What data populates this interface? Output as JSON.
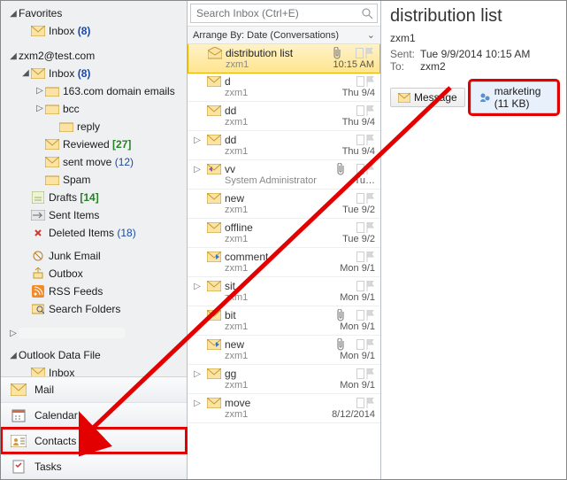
{
  "nav": {
    "favorites": {
      "label": "Favorites",
      "inbox": "Inbox",
      "inbox_count": "(8)"
    },
    "accounts": [
      {
        "name": "zxm2@test.com",
        "folders": {
          "inbox": "Inbox",
          "inbox_count": "(8)",
          "sub": {
            "f163": "163.com domain emails",
            "bcc": "bcc",
            "reply": "reply",
            "reviewed": "Reviewed",
            "reviewed_count": "[27]",
            "sentmove": "sent move",
            "sentmove_count": "(12)",
            "spam": "Spam"
          },
          "drafts": "Drafts",
          "drafts_count": "[14]",
          "sent": "Sent Items",
          "deleted": "Deleted Items",
          "deleted_count": "(18)",
          "junk": "Junk Email",
          "outbox": "Outbox",
          "rss": "RSS Feeds",
          "searchf": "Search Folders"
        }
      }
    ],
    "outlook_data_file": {
      "label": "Outlook Data File",
      "inbox": "Inbox"
    },
    "switch": {
      "mail": "Mail",
      "calendar": "Calendar",
      "contacts": "Contacts",
      "tasks": "Tasks"
    }
  },
  "search": {
    "placeholder": "Search Inbox (Ctrl+E)"
  },
  "arrange": {
    "label": "Arrange By: Date (Conversations)"
  },
  "messages": [
    {
      "subject": "distribution list",
      "from": "zxm1",
      "date": "10:15 AM",
      "attach": true,
      "selected": true,
      "env": "open"
    },
    {
      "subject": "d",
      "from": "zxm1",
      "date": "Thu 9/4",
      "env": "closed"
    },
    {
      "subject": "dd",
      "from": "zxm1",
      "date": "Thu 9/4",
      "env": "closed"
    },
    {
      "subject": "dd",
      "from": "zxm1",
      "date": "Thu 9/4",
      "expander": true,
      "env": "closed"
    },
    {
      "subject": "vv",
      "from": "System Administrator",
      "date": "Tu…",
      "attach": true,
      "expander": true,
      "env": "reply"
    },
    {
      "subject": "new",
      "from": "zxm1",
      "date": "Tue 9/2",
      "env": "closed"
    },
    {
      "subject": "offline",
      "from": "zxm1",
      "date": "Tue 9/2",
      "env": "closed"
    },
    {
      "subject": "comment",
      "from": "zxm1",
      "date": "Mon 9/1",
      "env": "fwd"
    },
    {
      "subject": "sit",
      "from": "zxm1",
      "date": "Mon 9/1",
      "expander": true,
      "env": "closed"
    },
    {
      "subject": "bit",
      "from": "zxm1",
      "date": "Mon 9/1",
      "attach": true,
      "env": "closed"
    },
    {
      "subject": "new",
      "from": "zxm1",
      "date": "Mon 9/1",
      "attach": true,
      "env": "fwd"
    },
    {
      "subject": "gg",
      "from": "zxm1",
      "date": "Mon 9/1",
      "expander": true,
      "env": "closed"
    },
    {
      "subject": "move",
      "from": "zxm1",
      "date": "8/12/2014",
      "expander": true,
      "env": "closed"
    }
  ],
  "reading": {
    "title": "distribution list",
    "from": "zxm1",
    "sent_lbl": "Sent:",
    "sent": "Tue 9/9/2014 10:15 AM",
    "to_lbl": "To:",
    "to": "zxm2",
    "tabs": {
      "message": "Message",
      "attachment": "marketing (11 KB)"
    }
  }
}
